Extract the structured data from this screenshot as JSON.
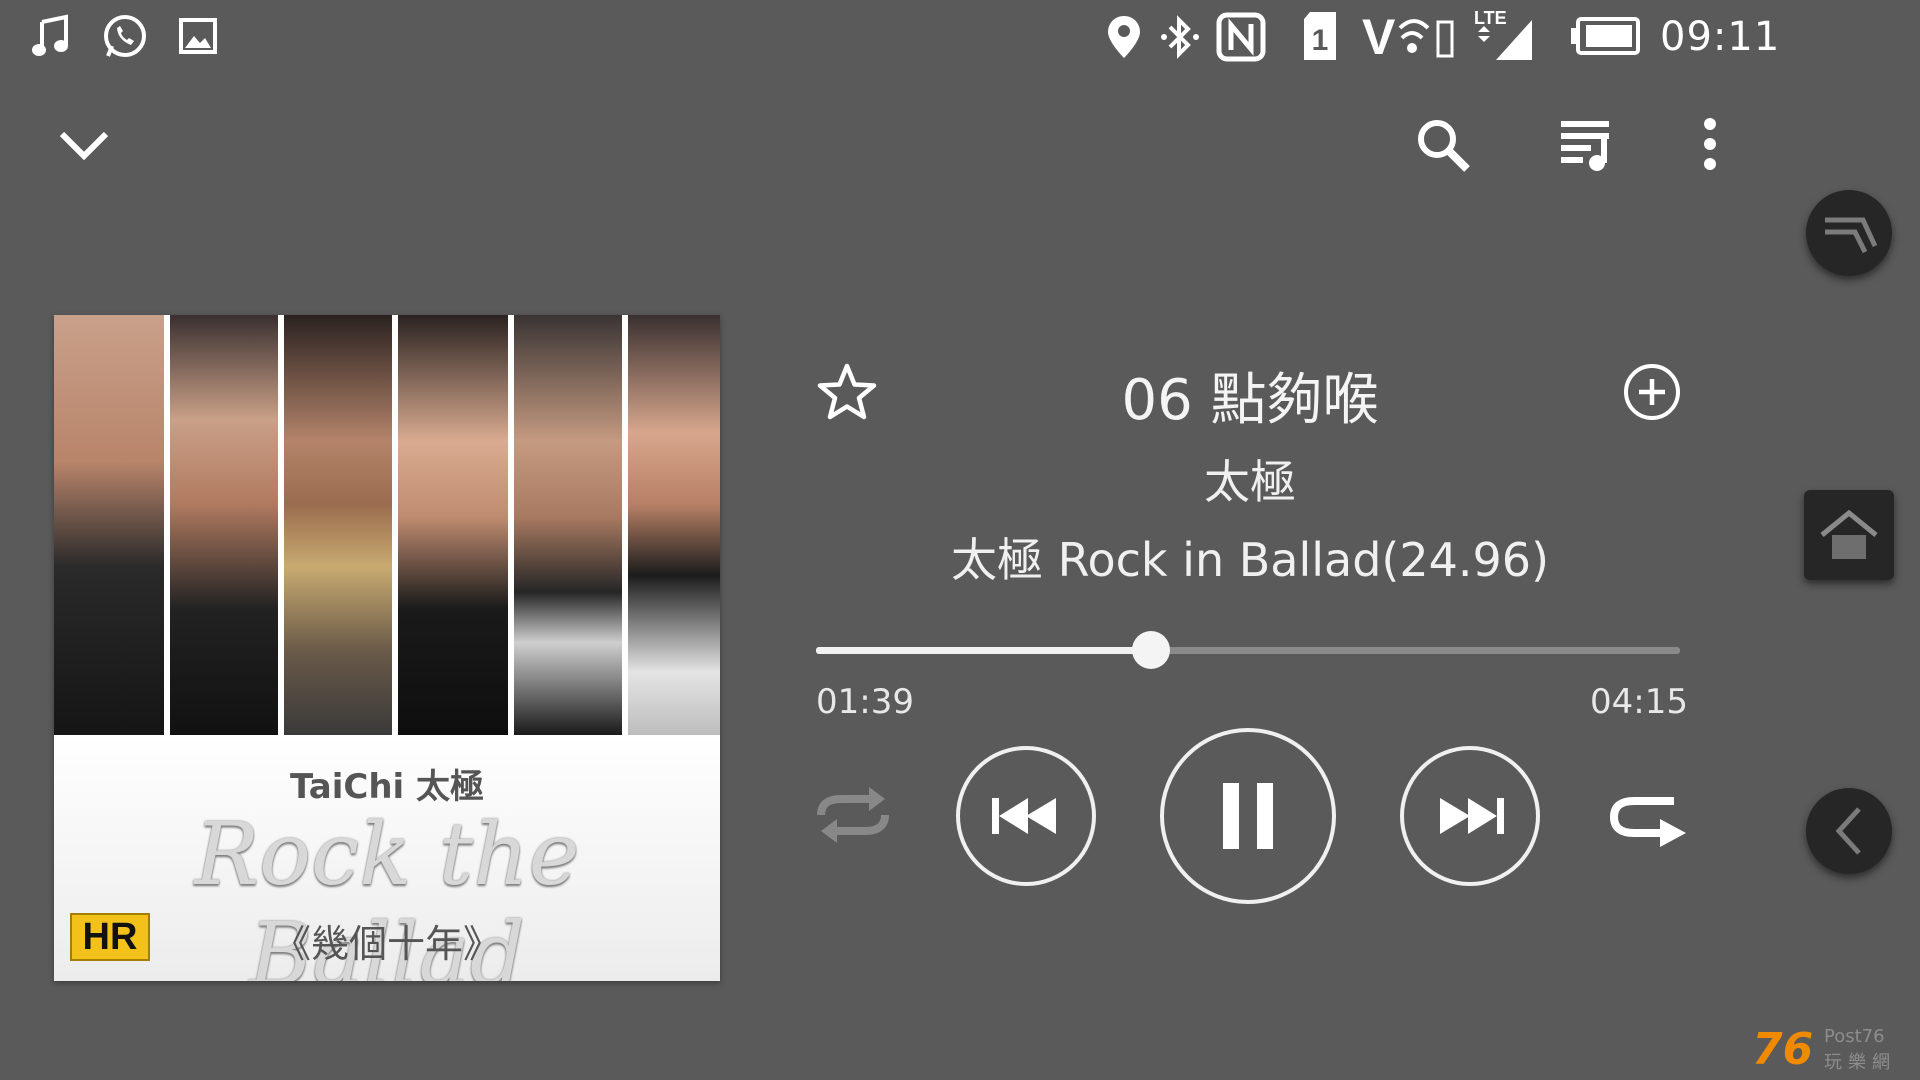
{
  "status_bar": {
    "left_icons": [
      "music-note-icon",
      "whatsapp-icon",
      "gallery-image-icon"
    ],
    "right_icons": [
      "location-pin-icon",
      "bluetooth-icon",
      "nfc-icon",
      "sim-1-icon",
      "volte-icon",
      "lte-signal-icon",
      "battery-icon"
    ],
    "sim_number": "1",
    "volte_label": "V",
    "lte_label": "LTE",
    "clock": "09:11"
  },
  "toolbar": {
    "icons": [
      "chevron-down-icon",
      "search-icon",
      "queue-icon",
      "more-vert-icon"
    ]
  },
  "album_art": {
    "artist_text": "TaiChi 太極",
    "script_title": "Rock the Ballad",
    "subtitle": "《幾個十年》",
    "badge": "HR"
  },
  "track": {
    "title": "06 點夠喉",
    "artist": "太極",
    "album": "太極 Rock in Ballad(24.96)",
    "elapsed": "01:39",
    "duration": "04:15",
    "progress": 0.388
  },
  "controls": {
    "icons": [
      "favorite-star-icon",
      "add-to-playlist-icon",
      "shuffle-icon",
      "previous-icon",
      "pause-icon",
      "next-icon",
      "repeat-icon"
    ]
  },
  "nav_overlay": {
    "icons": [
      "recent-apps-icon",
      "home-icon",
      "back-icon"
    ]
  },
  "watermark": {
    "number": "76",
    "brand": "Post76",
    "chinese": "玩樂網"
  },
  "colors": {
    "background": "#5a5a5a",
    "foreground": "#f2f2f2",
    "track_inactive": "#8a8a8a",
    "nav_button": "#262626",
    "badge": "#f2c21a",
    "watermark": "#f08a00"
  }
}
